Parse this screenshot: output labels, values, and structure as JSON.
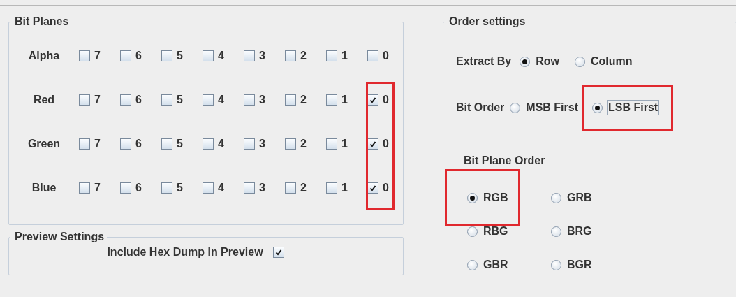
{
  "bit_planes": {
    "title": "Bit Planes",
    "rows": [
      {
        "label": "Alpha",
        "bits": [
          {
            "label": "7",
            "checked": false,
            "highlighted": false
          },
          {
            "label": "6",
            "checked": false,
            "highlighted": false
          },
          {
            "label": "5",
            "checked": false,
            "highlighted": false
          },
          {
            "label": "4",
            "checked": false,
            "highlighted": false
          },
          {
            "label": "3",
            "checked": false,
            "highlighted": false
          },
          {
            "label": "2",
            "checked": false,
            "highlighted": false
          },
          {
            "label": "1",
            "checked": false,
            "highlighted": false
          },
          {
            "label": "0",
            "checked": false,
            "highlighted": false
          }
        ]
      },
      {
        "label": "Red",
        "bits": [
          {
            "label": "7",
            "checked": false,
            "highlighted": false
          },
          {
            "label": "6",
            "checked": false,
            "highlighted": false
          },
          {
            "label": "5",
            "checked": false,
            "highlighted": false
          },
          {
            "label": "4",
            "checked": false,
            "highlighted": false
          },
          {
            "label": "3",
            "checked": false,
            "highlighted": false
          },
          {
            "label": "2",
            "checked": false,
            "highlighted": false
          },
          {
            "label": "1",
            "checked": false,
            "highlighted": false
          },
          {
            "label": "0",
            "checked": true,
            "highlighted": true
          }
        ]
      },
      {
        "label": "Green",
        "bits": [
          {
            "label": "7",
            "checked": false,
            "highlighted": false
          },
          {
            "label": "6",
            "checked": false,
            "highlighted": false
          },
          {
            "label": "5",
            "checked": false,
            "highlighted": false
          },
          {
            "label": "4",
            "checked": false,
            "highlighted": false
          },
          {
            "label": "3",
            "checked": false,
            "highlighted": false
          },
          {
            "label": "2",
            "checked": false,
            "highlighted": false
          },
          {
            "label": "1",
            "checked": false,
            "highlighted": false
          },
          {
            "label": "0",
            "checked": true,
            "highlighted": true
          }
        ]
      },
      {
        "label": "Blue",
        "bits": [
          {
            "label": "7",
            "checked": false,
            "highlighted": false
          },
          {
            "label": "6",
            "checked": false,
            "highlighted": false
          },
          {
            "label": "5",
            "checked": false,
            "highlighted": false
          },
          {
            "label": "4",
            "checked": false,
            "highlighted": false
          },
          {
            "label": "3",
            "checked": false,
            "highlighted": false
          },
          {
            "label": "2",
            "checked": false,
            "highlighted": false
          },
          {
            "label": "1",
            "checked": false,
            "highlighted": false
          },
          {
            "label": "0",
            "checked": true,
            "highlighted": true
          }
        ]
      }
    ]
  },
  "preview_settings": {
    "title": "Preview Settings",
    "include_hex_dump": {
      "label": "Include Hex Dump In Preview",
      "checked": true
    }
  },
  "order_settings": {
    "title": "Order settings",
    "extract_by": {
      "label": "Extract By",
      "options": [
        {
          "label": "Row",
          "selected": true,
          "focused": false,
          "highlighted": false
        },
        {
          "label": "Column",
          "selected": false,
          "focused": false,
          "highlighted": false
        }
      ]
    },
    "bit_order": {
      "label": "Bit Order",
      "options": [
        {
          "label": "MSB First",
          "selected": false,
          "focused": false,
          "highlighted": false
        },
        {
          "label": "LSB First",
          "selected": true,
          "focused": true,
          "highlighted": true
        }
      ]
    },
    "bit_plane_order": {
      "label": "Bit Plane Order",
      "options": [
        {
          "label": "RGB",
          "selected": true,
          "focused": false,
          "highlighted": true
        },
        {
          "label": "GRB",
          "selected": false,
          "focused": false,
          "highlighted": false
        },
        {
          "label": "RBG",
          "selected": false,
          "focused": false,
          "highlighted": false
        },
        {
          "label": "BRG",
          "selected": false,
          "focused": false,
          "highlighted": false
        },
        {
          "label": "GBR",
          "selected": false,
          "focused": false,
          "highlighted": false
        },
        {
          "label": "BGR",
          "selected": false,
          "focused": false,
          "highlighted": false
        }
      ]
    }
  }
}
